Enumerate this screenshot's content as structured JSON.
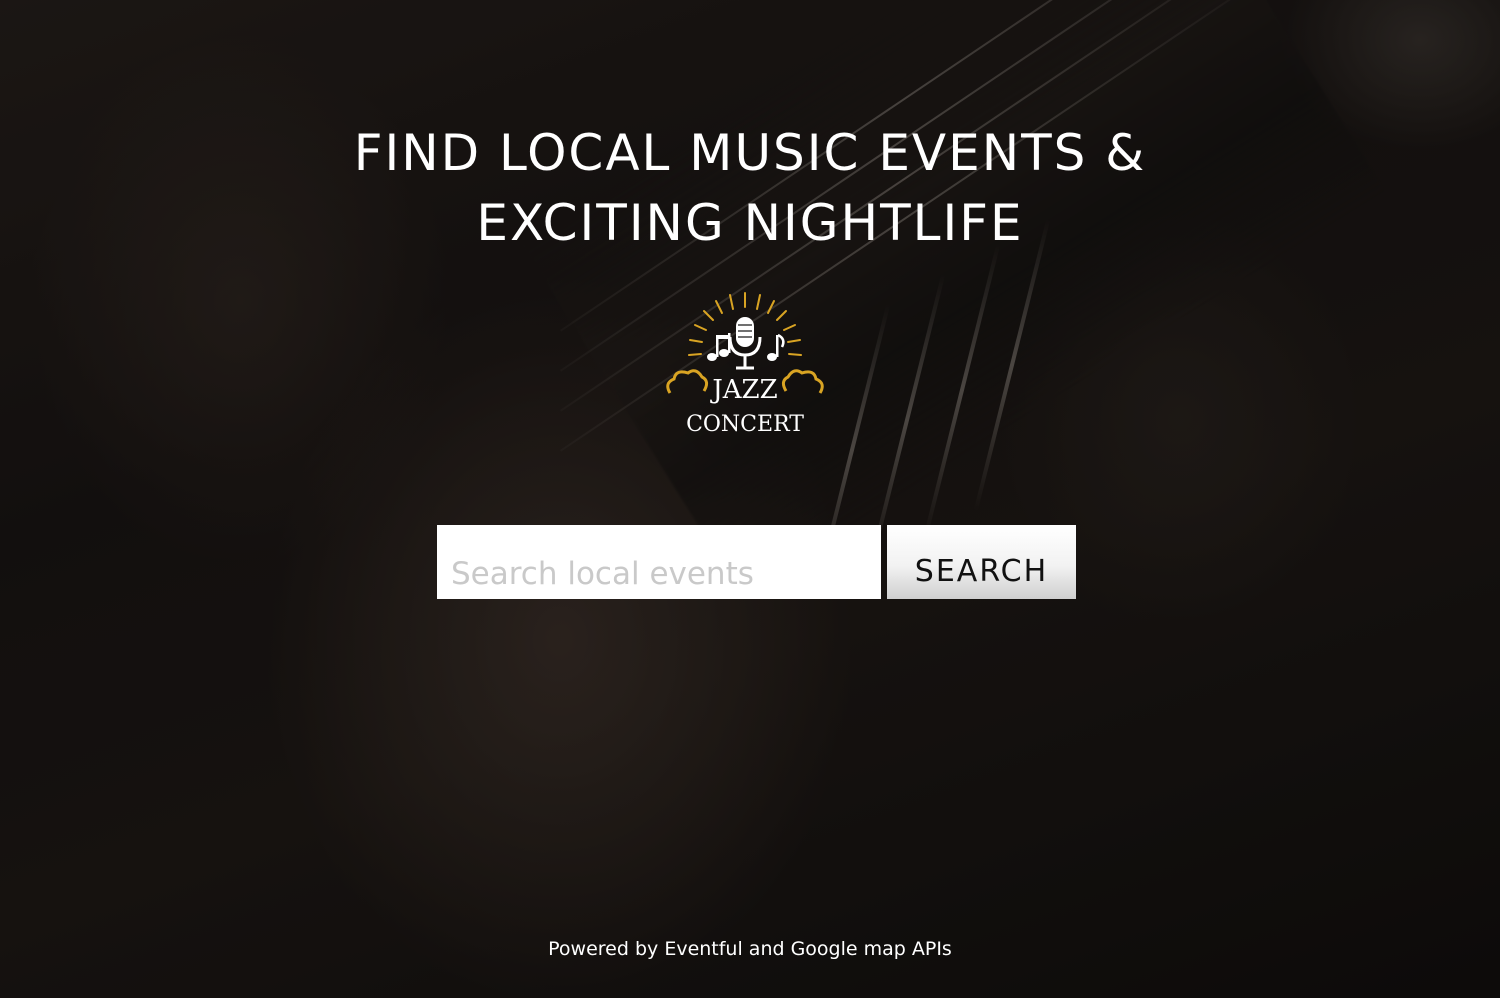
{
  "hero": {
    "title_line1": "FIND LOCAL MUSIC EVENTS &",
    "title_line2": "EXCITING NIGHTLIFE"
  },
  "logo": {
    "line1": "JAZZ",
    "line2": "CONCERT",
    "icon": "microphone-icon",
    "accent_color": "#d9a423"
  },
  "search": {
    "placeholder": "Search local events",
    "value": "",
    "button_label": "SEARCH"
  },
  "footer": {
    "text": "Powered by Eventful and Google map APIs"
  }
}
